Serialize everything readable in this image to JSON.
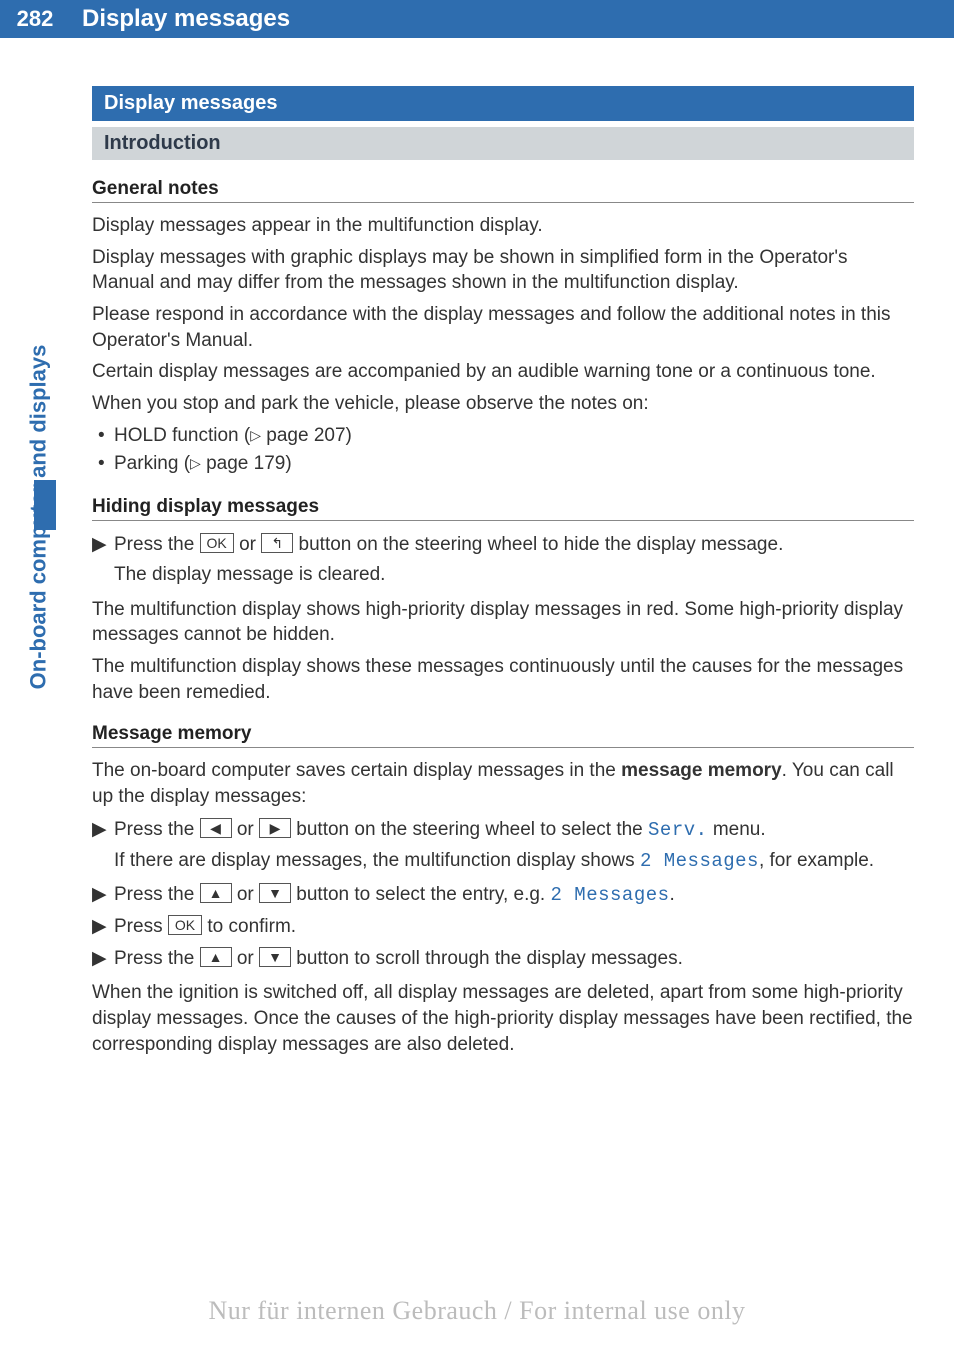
{
  "header": {
    "page_number": "282",
    "title": "Display messages"
  },
  "side_tab": "On-board computer and displays",
  "sections": {
    "main_title": "Display messages",
    "sub_title": "Introduction"
  },
  "general_notes": {
    "heading": "General notes",
    "p1": "Display messages appear in the multifunction display.",
    "p2": "Display messages with graphic displays may be shown in simplified form in the Operator's Manual and may differ from the messages shown in the multifunction display.",
    "p3": "Please respond in accordance with the display messages and follow the additional notes in this Operator's Manual.",
    "p4": "Certain display messages are accompanied by an audible warning tone or a continuous tone.",
    "p5": "When you stop and park the vehicle, please observe the notes on:",
    "bullets": {
      "b1_pre": "HOLD function (",
      "b1_page": " page 207)",
      "b2_pre": "Parking (",
      "b2_page": " page 179)"
    }
  },
  "hiding": {
    "heading": "Hiding display messages",
    "step1_pre": "Press the ",
    "step1_mid": " or ",
    "step1_post": " button on the steering wheel to hide the display message.",
    "step1_note": "The display message is cleared.",
    "p1": "The multifunction display shows high-priority display messages in red. Some high-priority display messages cannot be hidden.",
    "p2": "The multifunction display shows these messages continuously until the causes for the messages have been remedied."
  },
  "memory": {
    "heading": "Message memory",
    "intro_pre": "The on-board computer saves certain display messages in the ",
    "intro_bold": "message memory",
    "intro_post": ". You can call up the display messages:",
    "s1_pre": "Press the ",
    "s1_mid": " or ",
    "s1_post": " button on the steering wheel to select the ",
    "s1_menu": "Serv.",
    "s1_end": " menu.",
    "s1_note_pre": "If there are display messages, the multifunction display shows ",
    "s1_note_disp": "2 Messages",
    "s1_note_post": ", for example.",
    "s2_pre": "Press the ",
    "s2_mid": " or ",
    "s2_post": " button to select the entry, e.g. ",
    "s2_disp": "2 Messages",
    "s2_end": ".",
    "s3_pre": "Press ",
    "s3_post": " to confirm.",
    "s4_pre": "Press the ",
    "s4_mid": " or ",
    "s4_post": " button to scroll through the display messages.",
    "p_end": "When the ignition is switched off, all display messages are deleted, apart from some high-priority display messages. Once the causes of the high-priority display messages have been rectified, the corresponding display messages are also deleted."
  },
  "keys": {
    "ok": "OK",
    "back": "↰",
    "left": "◀",
    "right": "▶",
    "up": "▲",
    "down": "▼",
    "ref": "▷"
  },
  "watermark": "Nur für internen Gebrauch / For internal use only"
}
